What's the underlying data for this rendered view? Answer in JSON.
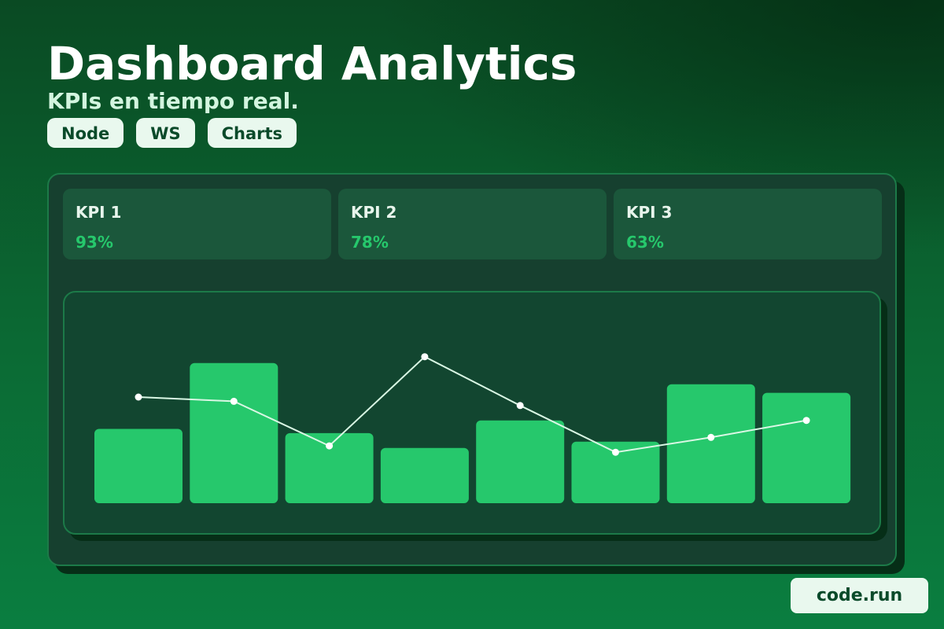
{
  "header": {
    "title": "Dashboard Analytics",
    "subtitle": "KPIs en tiempo real."
  },
  "tags": [
    "Node",
    "WS",
    "Charts"
  ],
  "kpis": [
    {
      "label": "KPI 1",
      "value": "93%"
    },
    {
      "label": "KPI 2",
      "value": "78%"
    },
    {
      "label": "KPI 3",
      "value": "63%"
    }
  ],
  "chart_data": {
    "type": "bar",
    "categories": [
      "",
      "",
      "",
      "",
      "",
      "",
      "",
      ""
    ],
    "series": [
      {
        "values": [
          35,
          66,
          33,
          26,
          39,
          29,
          56,
          52
        ]
      },
      {
        "values": [
          50,
          48,
          27,
          69,
          46,
          24,
          31,
          39
        ]
      }
    ],
    "ylim": [
      0,
      100
    ],
    "grid": false,
    "colors": {
      "bars": "#26c86c",
      "line": "#d9f7e4",
      "points": "#ffffff"
    }
  },
  "footer": {
    "badge": "code.run"
  },
  "colors": {
    "accent": "#26c86c",
    "panel": "#16402f",
    "card": "#1b573b",
    "border": "#1c7a48",
    "tag_bg": "#e9f8ee",
    "tag_text": "#0a4a2a"
  }
}
